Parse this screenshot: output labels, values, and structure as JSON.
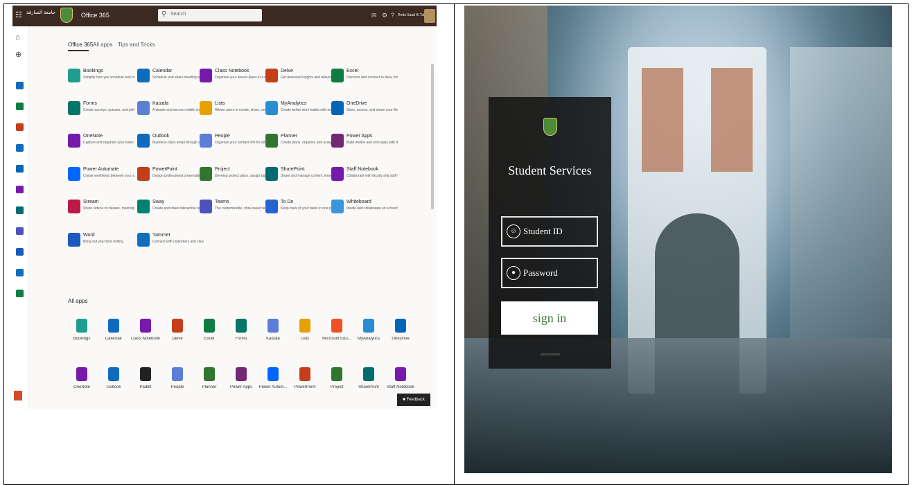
{
  "office": {
    "org_logo_text": "جامعة الشارقة",
    "app_title": "Office 365",
    "search_placeholder": "Search",
    "user_name": "Reda Saad Al Tallis",
    "tabs": [
      "Office 365",
      "All apps",
      "Tips and Tricks"
    ],
    "apps": [
      {
        "name": "Bookings",
        "desc": "Simplify how you schedule and ma...",
        "color": "#1f9e8f"
      },
      {
        "name": "Calendar",
        "desc": "Schedule and share meeting and e...",
        "color": "#0f6cbd"
      },
      {
        "name": "Class Notebook",
        "desc": "Organize your lesson plans in a di...",
        "color": "#7719aa"
      },
      {
        "name": "Delve",
        "desc": "Get personal insights and relevant...",
        "color": "#c43e1c"
      },
      {
        "name": "Excel",
        "desc": "Discover and connect to data, mo...",
        "color": "#107c41"
      },
      {
        "name": "Forms",
        "desc": "Create surveys, quizzes, and polls...",
        "color": "#077568"
      },
      {
        "name": "Kaizala",
        "desc": "A simple and secure mobile chat a...",
        "color": "#5b7fd6"
      },
      {
        "name": "Lists",
        "desc": "Allows users to create, share, and t...",
        "color": "#e8a000"
      },
      {
        "name": "MyAnalytics",
        "desc": "Create better work habits with ins...",
        "color": "#2a8dd4"
      },
      {
        "name": "OneDrive",
        "desc": "Store, access, and share your files i...",
        "color": "#0364b8"
      },
      {
        "name": "OneNote",
        "desc": "Capture and organize your notes a...",
        "color": "#7719aa"
      },
      {
        "name": "Outlook",
        "desc": "Business-class email through a ric...",
        "color": "#0f6cbd"
      },
      {
        "name": "People",
        "desc": "Organize your contact info for all y...",
        "color": "#5b7fd6"
      },
      {
        "name": "Planner",
        "desc": "Create plans, organize and assign t...",
        "color": "#31752f"
      },
      {
        "name": "Power Apps",
        "desc": "Build mobile and web apps with th...",
        "color": "#742774"
      },
      {
        "name": "Power Automate",
        "desc": "Create workflows between your ap...",
        "color": "#0066ff"
      },
      {
        "name": "PowerPoint",
        "desc": "Design professional presentations.",
        "color": "#c43e1c"
      },
      {
        "name": "Project",
        "desc": "Develop project plans, assign tasks...",
        "color": "#31752f"
      },
      {
        "name": "SharePoint",
        "desc": "Share and manage content, knowl...",
        "color": "#036c70"
      },
      {
        "name": "Staff Notebook",
        "desc": "Collaborate with faculty and staff t...",
        "color": "#7719aa"
      },
      {
        "name": "Stream",
        "desc": "Share videos of classes, meetings,...",
        "color": "#bc1948"
      },
      {
        "name": "Sway",
        "desc": "Create and share interactive report...",
        "color": "#008272"
      },
      {
        "name": "Teams",
        "desc": "The customizable, chat-based tea...",
        "color": "#4b53bc"
      },
      {
        "name": "To Do",
        "desc": "Keep track of your tasks in one pla...",
        "color": "#2564cf"
      },
      {
        "name": "Whiteboard",
        "desc": "Ideate and collaborate on a freefor...",
        "color": "#3a96dd"
      },
      {
        "name": "Word",
        "desc": "Bring out your best writing.",
        "color": "#185abd"
      },
      {
        "name": "Yammer",
        "desc": "Connect with coworkers and class...",
        "color": "#106ebe"
      }
    ],
    "all_apps_heading": "All apps",
    "all_apps": [
      {
        "name": "Bookings",
        "color": "#1f9e8f"
      },
      {
        "name": "Calendar",
        "color": "#0f6cbd"
      },
      {
        "name": "Class Notebook",
        "color": "#7719aa"
      },
      {
        "name": "Delve",
        "color": "#c43e1c"
      },
      {
        "name": "Excel",
        "color": "#107c41"
      },
      {
        "name": "Forms",
        "color": "#077568"
      },
      {
        "name": "Kaizala",
        "color": "#5b7fd6"
      },
      {
        "name": "Lists",
        "color": "#e8a000"
      },
      {
        "name": "Microsoft Edu...",
        "color": "#f25022"
      },
      {
        "name": "MyAnalytics",
        "color": "#2a8dd4"
      },
      {
        "name": "OneDrive",
        "color": "#0364b8"
      },
      {
        "name": "OneNote",
        "color": "#7719aa"
      },
      {
        "name": "Outlook",
        "color": "#0f6cbd"
      },
      {
        "name": "Padlet",
        "color": "#222222"
      },
      {
        "name": "People",
        "color": "#5b7fd6"
      },
      {
        "name": "Planner",
        "color": "#31752f"
      },
      {
        "name": "Power Apps",
        "color": "#742774"
      },
      {
        "name": "Power Autom...",
        "color": "#0066ff"
      },
      {
        "name": "PowerPoint",
        "color": "#c43e1c"
      },
      {
        "name": "Project",
        "color": "#31752f"
      },
      {
        "name": "SharePoint",
        "color": "#036c70"
      },
      {
        "name": "Staff Notebook",
        "color": "#7719aa"
      }
    ],
    "feedback_label": "Feedback",
    "rail_colors": [
      "#0f6cbd",
      "#107c41",
      "#c43e1c",
      "#0f6cbd",
      "#0364b8",
      "#7719aa",
      "#036c70",
      "#4b53bc",
      "#185abd",
      "#106ebe",
      "#107c41"
    ]
  },
  "student_services": {
    "title": "Student Services",
    "student_id_placeholder": "Student ID",
    "password_placeholder": "Password",
    "signin_label": "sign in"
  }
}
